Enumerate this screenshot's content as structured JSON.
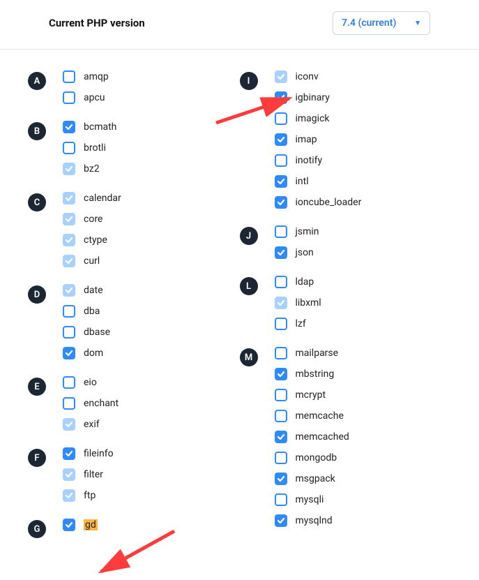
{
  "header": {
    "label": "Current PHP version",
    "dropdown_value": "7.4 (current)"
  },
  "left": [
    {
      "letter": "A",
      "items": [
        {
          "name": "amqp",
          "state": "empty"
        },
        {
          "name": "apcu",
          "state": "empty"
        }
      ]
    },
    {
      "letter": "B",
      "items": [
        {
          "name": "bcmath",
          "state": "checked"
        },
        {
          "name": "brotli",
          "state": "empty"
        },
        {
          "name": "bz2",
          "state": "locked"
        }
      ]
    },
    {
      "letter": "C",
      "items": [
        {
          "name": "calendar",
          "state": "locked"
        },
        {
          "name": "core",
          "state": "locked"
        },
        {
          "name": "ctype",
          "state": "locked"
        },
        {
          "name": "curl",
          "state": "locked"
        }
      ]
    },
    {
      "letter": "D",
      "items": [
        {
          "name": "date",
          "state": "locked"
        },
        {
          "name": "dba",
          "state": "empty"
        },
        {
          "name": "dbase",
          "state": "empty"
        },
        {
          "name": "dom",
          "state": "checked"
        }
      ]
    },
    {
      "letter": "E",
      "items": [
        {
          "name": "eio",
          "state": "empty"
        },
        {
          "name": "enchant",
          "state": "empty"
        },
        {
          "name": "exif",
          "state": "locked"
        }
      ]
    },
    {
      "letter": "F",
      "items": [
        {
          "name": "fileinfo",
          "state": "checked"
        },
        {
          "name": "filter",
          "state": "locked"
        },
        {
          "name": "ftp",
          "state": "locked"
        }
      ]
    },
    {
      "letter": "G",
      "items": [
        {
          "name": "gd",
          "state": "checked",
          "highlight": true
        }
      ]
    }
  ],
  "right": [
    {
      "letter": "I",
      "items": [
        {
          "name": "iconv",
          "state": "locked"
        },
        {
          "name": "igbinary",
          "state": "checked"
        },
        {
          "name": "imagick",
          "state": "empty"
        },
        {
          "name": "imap",
          "state": "checked"
        },
        {
          "name": "inotify",
          "state": "empty"
        },
        {
          "name": "intl",
          "state": "checked"
        },
        {
          "name": "ioncube_loader",
          "state": "checked"
        }
      ]
    },
    {
      "letter": "J",
      "items": [
        {
          "name": "jsmin",
          "state": "empty"
        },
        {
          "name": "json",
          "state": "checked"
        }
      ]
    },
    {
      "letter": "L",
      "items": [
        {
          "name": "ldap",
          "state": "empty"
        },
        {
          "name": "libxml",
          "state": "locked"
        },
        {
          "name": "lzf",
          "state": "empty"
        }
      ]
    },
    {
      "letter": "M",
      "items": [
        {
          "name": "mailparse",
          "state": "empty"
        },
        {
          "name": "mbstring",
          "state": "checked"
        },
        {
          "name": "mcrypt",
          "state": "empty"
        },
        {
          "name": "memcache",
          "state": "empty"
        },
        {
          "name": "memcached",
          "state": "checked"
        },
        {
          "name": "mongodb",
          "state": "empty"
        },
        {
          "name": "msgpack",
          "state": "checked"
        },
        {
          "name": "mysqli",
          "state": "empty"
        },
        {
          "name": "mysqlnd",
          "state": "checked"
        }
      ]
    }
  ]
}
